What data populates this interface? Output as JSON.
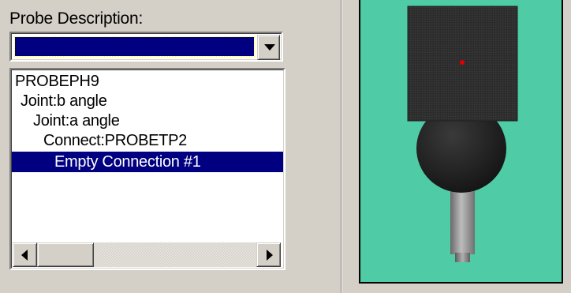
{
  "probe_description": {
    "label": "Probe Description:",
    "selected_value": ""
  },
  "tree": {
    "items": [
      {
        "label": "PROBEPH9",
        "level": 0,
        "selected": false
      },
      {
        "label": "Joint:b angle",
        "level": 1,
        "selected": false
      },
      {
        "label": "Joint:a angle",
        "level": 2,
        "selected": false
      },
      {
        "label": "Connect:PROBETP2",
        "level": 3,
        "selected": false
      },
      {
        "label": "Empty Connection #1",
        "level": 4,
        "selected": true
      }
    ]
  },
  "icons": {
    "dropdown": "chevron-down-icon",
    "scroll_left": "arrow-left-icon",
    "scroll_right": "arrow-right-icon"
  },
  "colors": {
    "window_bg": "#d4d0c8",
    "selection": "#000080",
    "preview_bg": "#4fcba6",
    "probe_body": "#2e2e2e",
    "probe_point": "#e00000"
  }
}
